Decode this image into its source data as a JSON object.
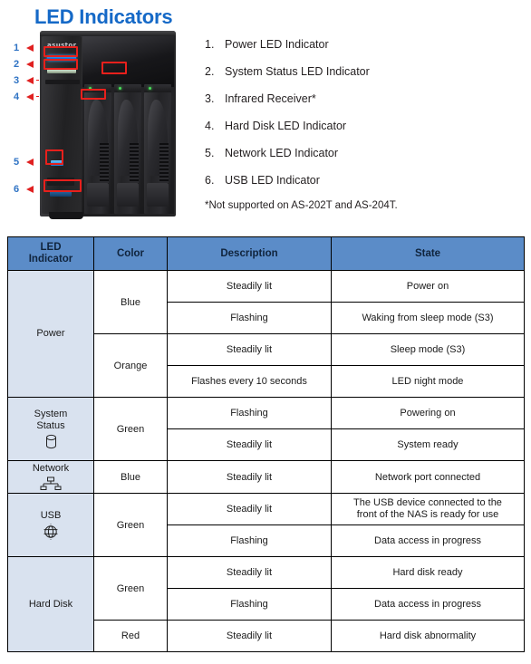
{
  "title": "LED Indicators",
  "brand": "asustor",
  "callouts": [
    {
      "num": "1"
    },
    {
      "num": "2"
    },
    {
      "num": "3"
    },
    {
      "num": "4"
    },
    {
      "num": "5"
    },
    {
      "num": "6"
    }
  ],
  "list": [
    {
      "idx": "1.",
      "label": "Power LED Indicator"
    },
    {
      "idx": "2.",
      "label": "System Status LED Indicator"
    },
    {
      "idx": "3.",
      "label": "Infrared Receiver*"
    },
    {
      "idx": "4.",
      "label": "Hard Disk LED Indicator"
    },
    {
      "idx": "5.",
      "label": "Network LED Indicator"
    },
    {
      "idx": "6.",
      "label": "USB LED Indicator"
    }
  ],
  "footnote": "*Not supported on AS-202T and AS-204T.",
  "table": {
    "headers": [
      "LED Indicator",
      "Color",
      "Description",
      "State"
    ],
    "header_line1": "LED",
    "header_line2": "Indicator",
    "indicators": {
      "power": "Power",
      "system_status_line1": "System",
      "system_status_line2": "Status",
      "network": "Network",
      "usb": "USB",
      "hard_disk": "Hard Disk"
    },
    "icons": {
      "system_status": "database-cylinder-icon",
      "network": "network-tree-icon",
      "usb": "usb-globe-icon"
    },
    "rows": [
      {
        "color": "Blue",
        "description": "Steadily lit",
        "state": "Power on"
      },
      {
        "color": "Blue",
        "description": "Flashing",
        "state": "Waking from sleep mode (S3)"
      },
      {
        "color": "Orange",
        "description": "Steadily lit",
        "state": "Sleep mode (S3)"
      },
      {
        "color": "Orange",
        "description": "Flashes every 10 seconds",
        "state": "LED night mode"
      },
      {
        "color": "Green",
        "description": "Flashing",
        "state": "Powering on"
      },
      {
        "color": "Green",
        "description": "Steadily lit",
        "state": "System ready"
      },
      {
        "color": "Blue",
        "description": "Steadily lit",
        "state": "Network port connected"
      },
      {
        "color": "Green",
        "description": "Steadily lit",
        "state_line1": "The USB device connected to the",
        "state_line2": "front of the NAS is ready for use"
      },
      {
        "color": "Green",
        "description": "Flashing",
        "state": "Data access in progress"
      },
      {
        "color": "Green",
        "description": "Steadily lit",
        "state": "Hard disk ready"
      },
      {
        "color": "Green",
        "description": "Flashing",
        "state": "Data access in progress"
      },
      {
        "color": "Red",
        "description": "Steadily lit",
        "state": "Hard disk abnormality"
      }
    ]
  },
  "colors": {
    "title": "#1569c7",
    "table_header_bg": "#5b8cc8",
    "indicator_cell_bg": "#d9e2ef",
    "callout_number": "#2f73c4",
    "highlight_box": "#e8201c"
  }
}
